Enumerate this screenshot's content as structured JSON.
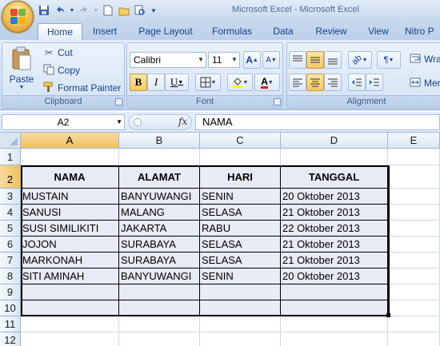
{
  "quick_access": {
    "save_icon": "save-icon",
    "undo_icon": "undo-icon",
    "redo_icon": "redo-icon",
    "new_icon": "new-document-icon",
    "open_icon": "open-folder-icon",
    "print_preview_icon": "print-preview-icon",
    "customize_icon": "customize-qat-icon"
  },
  "title": "Microsoft Excel - Microsoft Excel",
  "tabs": [
    {
      "label": "Home",
      "active": true
    },
    {
      "label": "Insert"
    },
    {
      "label": "Page Layout"
    },
    {
      "label": "Formulas"
    },
    {
      "label": "Data"
    },
    {
      "label": "Review"
    },
    {
      "label": "View"
    },
    {
      "label": "Nitro P"
    }
  ],
  "ribbon": {
    "clipboard": {
      "label": "Clipboard",
      "paste": "Paste",
      "cut": "Cut",
      "copy": "Copy",
      "format_painter": "Format Painter"
    },
    "font": {
      "label": "Font",
      "font_name": "Calibri",
      "font_size": "11",
      "bold": "B",
      "italic": "I",
      "underline": "U",
      "grow": "A",
      "shrink": "A",
      "font_color_letter": "A"
    },
    "alignment": {
      "label": "Alignment",
      "wrap_text": "Wra",
      "merge": "Mer"
    }
  },
  "formula_bar": {
    "name_box": "A2",
    "fx": "fx",
    "value": "NAMA"
  },
  "columns": [
    "A",
    "B",
    "C",
    "D",
    "E"
  ],
  "rows": [
    "1",
    "2",
    "3",
    "4",
    "5",
    "6",
    "7",
    "8",
    "9",
    "10",
    "11",
    "12"
  ],
  "table": {
    "headers": [
      "NAMA",
      "ALAMAT",
      "HARI",
      "TANGGAL"
    ],
    "rows": [
      [
        "MUSTAIN",
        "BANYUWANGI",
        "SENIN",
        "20 Oktober 2013"
      ],
      [
        "SANUSI",
        "MALANG",
        "SELASA",
        "21 Oktober 2013"
      ],
      [
        "SUSI SIMILIKITI",
        "JAKARTA",
        "RABU",
        "22 Oktober 2013"
      ],
      [
        "JOJON",
        "SURABAYA",
        "SELASA",
        "21 Oktober 2013"
      ],
      [
        "MARKONAH",
        "SURABAYA",
        "SELASA",
        "21 Oktober 2013"
      ],
      [
        "SITI AMINAH",
        "BANYUWANGI",
        "SENIN",
        "20 Oktober 2013"
      ],
      [
        "",
        "",
        "",
        ""
      ],
      [
        "",
        "",
        "",
        ""
      ]
    ]
  },
  "colors": {
    "table_fill": "#e8eaf6",
    "selected_header": "#f1c15f",
    "ribbon_text": "#15428b"
  }
}
